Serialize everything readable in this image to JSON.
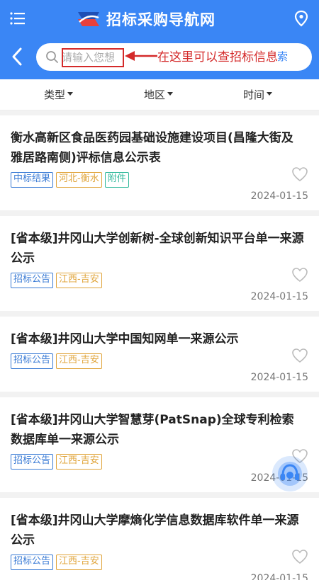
{
  "header": {
    "title": "招标采购导航网",
    "brand_color": "#3a86f5"
  },
  "search": {
    "placeholder": "请输入您想",
    "button_label": "索",
    "annotation": "在这里可以查招标信息"
  },
  "filters": [
    {
      "label": "类型"
    },
    {
      "label": "地区"
    },
    {
      "label": "时间"
    }
  ],
  "items": [
    {
      "title": "衡水高新区食品医药园基础设施建设项目(昌隆大街及雅居路南侧)评标信息公示表",
      "tags": [
        "中标结果",
        "河北-衡水",
        "附件"
      ],
      "date": "2024-01-15"
    },
    {
      "title": "[省本级]井冈山大学创新树-全球创新知识平台单一来源公示",
      "tags": [
        "招标公告",
        "江西-吉安"
      ],
      "date": "2024-01-15"
    },
    {
      "title": "[省本级]井冈山大学中国知网单一来源公示",
      "tags": [
        "招标公告",
        "江西-吉安"
      ],
      "date": "2024-01-15"
    },
    {
      "title": "[省本级]井冈山大学智慧芽(PatSnap)全球专利检索数据库单一来源公示",
      "tags": [
        "招标公告",
        "江西-吉安"
      ],
      "date": "2024-01-15"
    },
    {
      "title": "[省本级]井冈山大学摩熵化学信息数据库软件单一来源公示",
      "tags": [
        "招标公告",
        "江西-吉安"
      ],
      "date": "2024-01-15"
    }
  ],
  "icons": {
    "menu": "menu-icon",
    "location": "location-pin-icon",
    "back": "back-arrow-icon",
    "search": "search-icon",
    "favorite": "heart-icon",
    "support": "customer-service-icon"
  }
}
